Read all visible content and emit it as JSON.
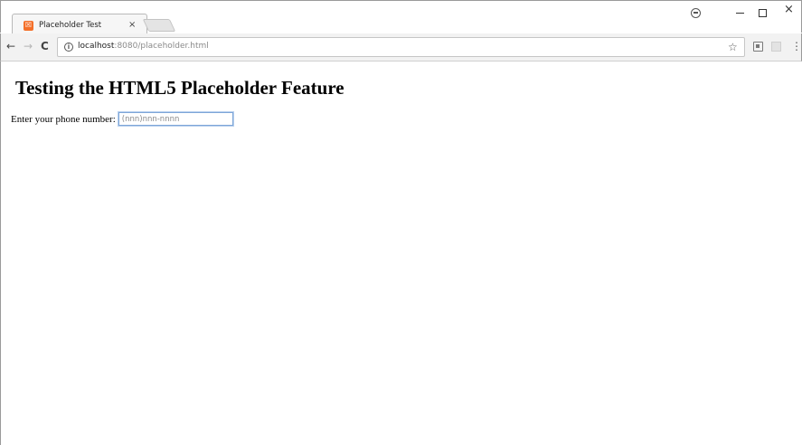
{
  "browser": {
    "tab": {
      "title": "Placeholder Test",
      "favicon_glyph": "☒",
      "close_glyph": "×",
      "favicon_color": "#f4702a"
    },
    "window_controls": {
      "close_glyph": "×"
    },
    "toolbar": {
      "back_glyph": "←",
      "forward_glyph": "→",
      "reload_glyph": "C",
      "info_glyph": "i",
      "url_host": "localhost",
      "url_rest": ":8080/placeholder.html",
      "star_glyph": "☆",
      "menu_glyph": "⋮"
    }
  },
  "page": {
    "heading": "Testing the HTML5 Placeholder Feature",
    "phone_label": "Enter your phone number: ",
    "phone_input": {
      "value": "",
      "placeholder": "(nnn)nnn-nnnn"
    }
  }
}
